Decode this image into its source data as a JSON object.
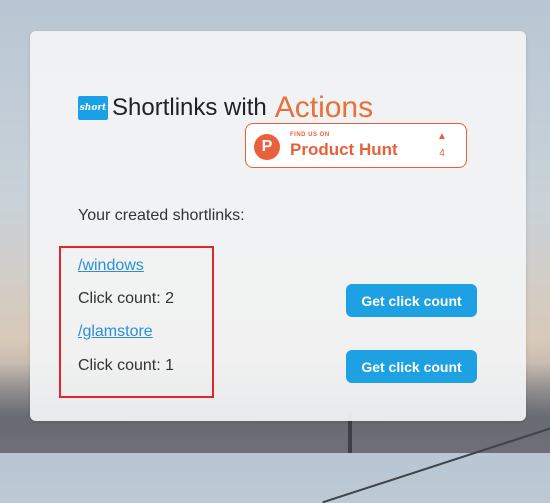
{
  "header": {
    "logo_text": "short",
    "title_main": "Shortlinks with",
    "title_accent": "Actions"
  },
  "product_hunt": {
    "small_text": "FIND US ON",
    "name": "Product Hunt",
    "logo_letter": "P",
    "vote_count": "4"
  },
  "section_label": "Your created shortlinks:",
  "shortlinks": [
    {
      "path": "/windows",
      "click_count_label": "Click count: 2",
      "button_label": "Get click count"
    },
    {
      "path": "/glamstore",
      "click_count_label": "Click count: 1",
      "button_label": "Get click count"
    }
  ],
  "colors": {
    "accent": "#e8703a",
    "button": "#1da1e2",
    "link": "#2a8fd6",
    "highlight_box": "#e3262b"
  }
}
